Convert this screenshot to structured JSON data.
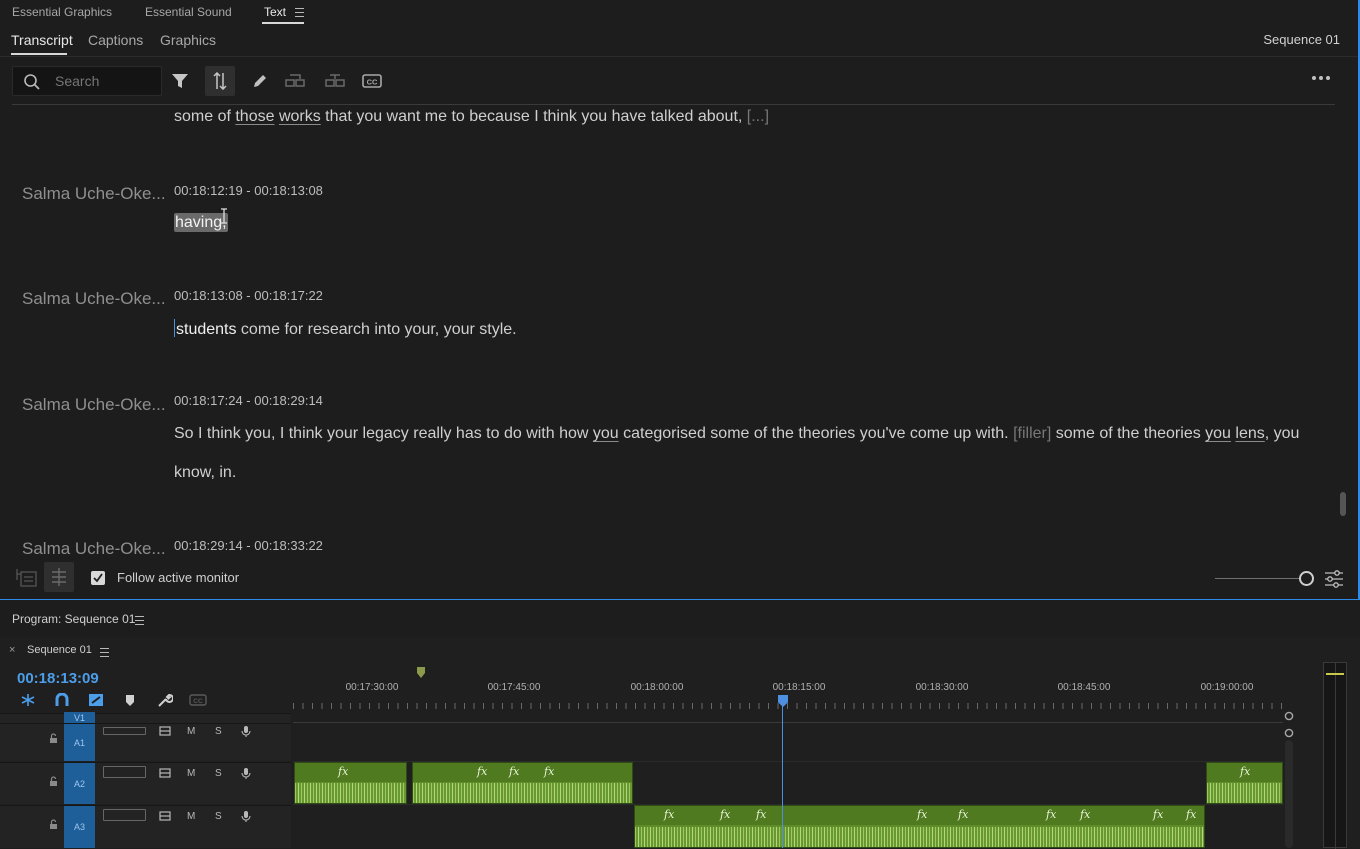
{
  "panel_tabs": [
    "Essential Graphics",
    "Essential Sound",
    "Text"
  ],
  "sub_tabs": [
    "Transcript",
    "Captions",
    "Graphics"
  ],
  "sequence_name": "Sequence 01",
  "search": {
    "placeholder": "Search"
  },
  "transcript": {
    "top_line": {
      "parts": [
        {
          "t": "some of "
        },
        {
          "t": "those",
          "u": true
        },
        {
          "t": " "
        },
        {
          "t": "works",
          "u": true
        },
        {
          "t": " that you want me to because I think you have talked about, "
        },
        {
          "t": "[...]",
          "dim": true
        }
      ]
    },
    "segments": [
      {
        "speaker": "Salma Uche-Oke...",
        "timecode": "00:18:12:19 - 00:18:13:08",
        "lines": [
          [
            {
              "t": "having,",
              "hl": true
            }
          ]
        ]
      },
      {
        "speaker": "Salma Uche-Oke...",
        "timecode": "00:18:13:08 - 00:18:17:22",
        "lines": [
          [
            {
              "t": "students",
              "bright": true,
              "caret": true
            },
            {
              "t": " come for research into your, your style."
            }
          ]
        ]
      },
      {
        "speaker": "Salma Uche-Oke...",
        "timecode": "00:18:17:24 - 00:18:29:14",
        "lines": [
          [
            {
              "t": "So I think you, I think your legacy really has to do with how "
            },
            {
              "t": "you",
              "u": true
            },
            {
              "t": " categorised some of the theories you've come up with. "
            },
            {
              "t": "[filler]",
              "dim": true
            },
            {
              "t": " some of the theories "
            },
            {
              "t": "you",
              "u": true
            },
            {
              "t": " "
            },
            {
              "t": "lens",
              "u": true
            },
            {
              "t": ", you"
            }
          ],
          [
            {
              "t": "know, in."
            }
          ]
        ]
      },
      {
        "speaker": "Salma Uche-Oke...",
        "timecode": "00:18:29:14 - 00:18:33:22",
        "lines": []
      }
    ]
  },
  "footer": {
    "follow_label": "Follow active monitor",
    "follow_checked": true
  },
  "program_monitor": {
    "title": "Program: Sequence 01"
  },
  "timeline": {
    "sequence_tab": "Sequence 01",
    "close_glyph": "×",
    "current_time": "00:18:13:09",
    "ruler_labels": [
      "00:17:30:00",
      "00:17:45:00",
      "00:18:00:00",
      "00:18:15:00",
      "00:18:30:00",
      "00:18:45:00",
      "00:19:00:00"
    ],
    "tracks": [
      {
        "label": "V1"
      },
      {
        "label": "A1",
        "m": "M",
        "s": "S"
      },
      {
        "label": "A2",
        "m": "M",
        "s": "S"
      },
      {
        "label": "A3",
        "m": "M",
        "s": "S"
      }
    ],
    "clip_fx_label": "fx"
  },
  "colors": {
    "accent": "#2d8ceb",
    "timecode": "#4c9eea",
    "audio_clip": "#5f8d2a",
    "track_label": "#1f5f99"
  }
}
